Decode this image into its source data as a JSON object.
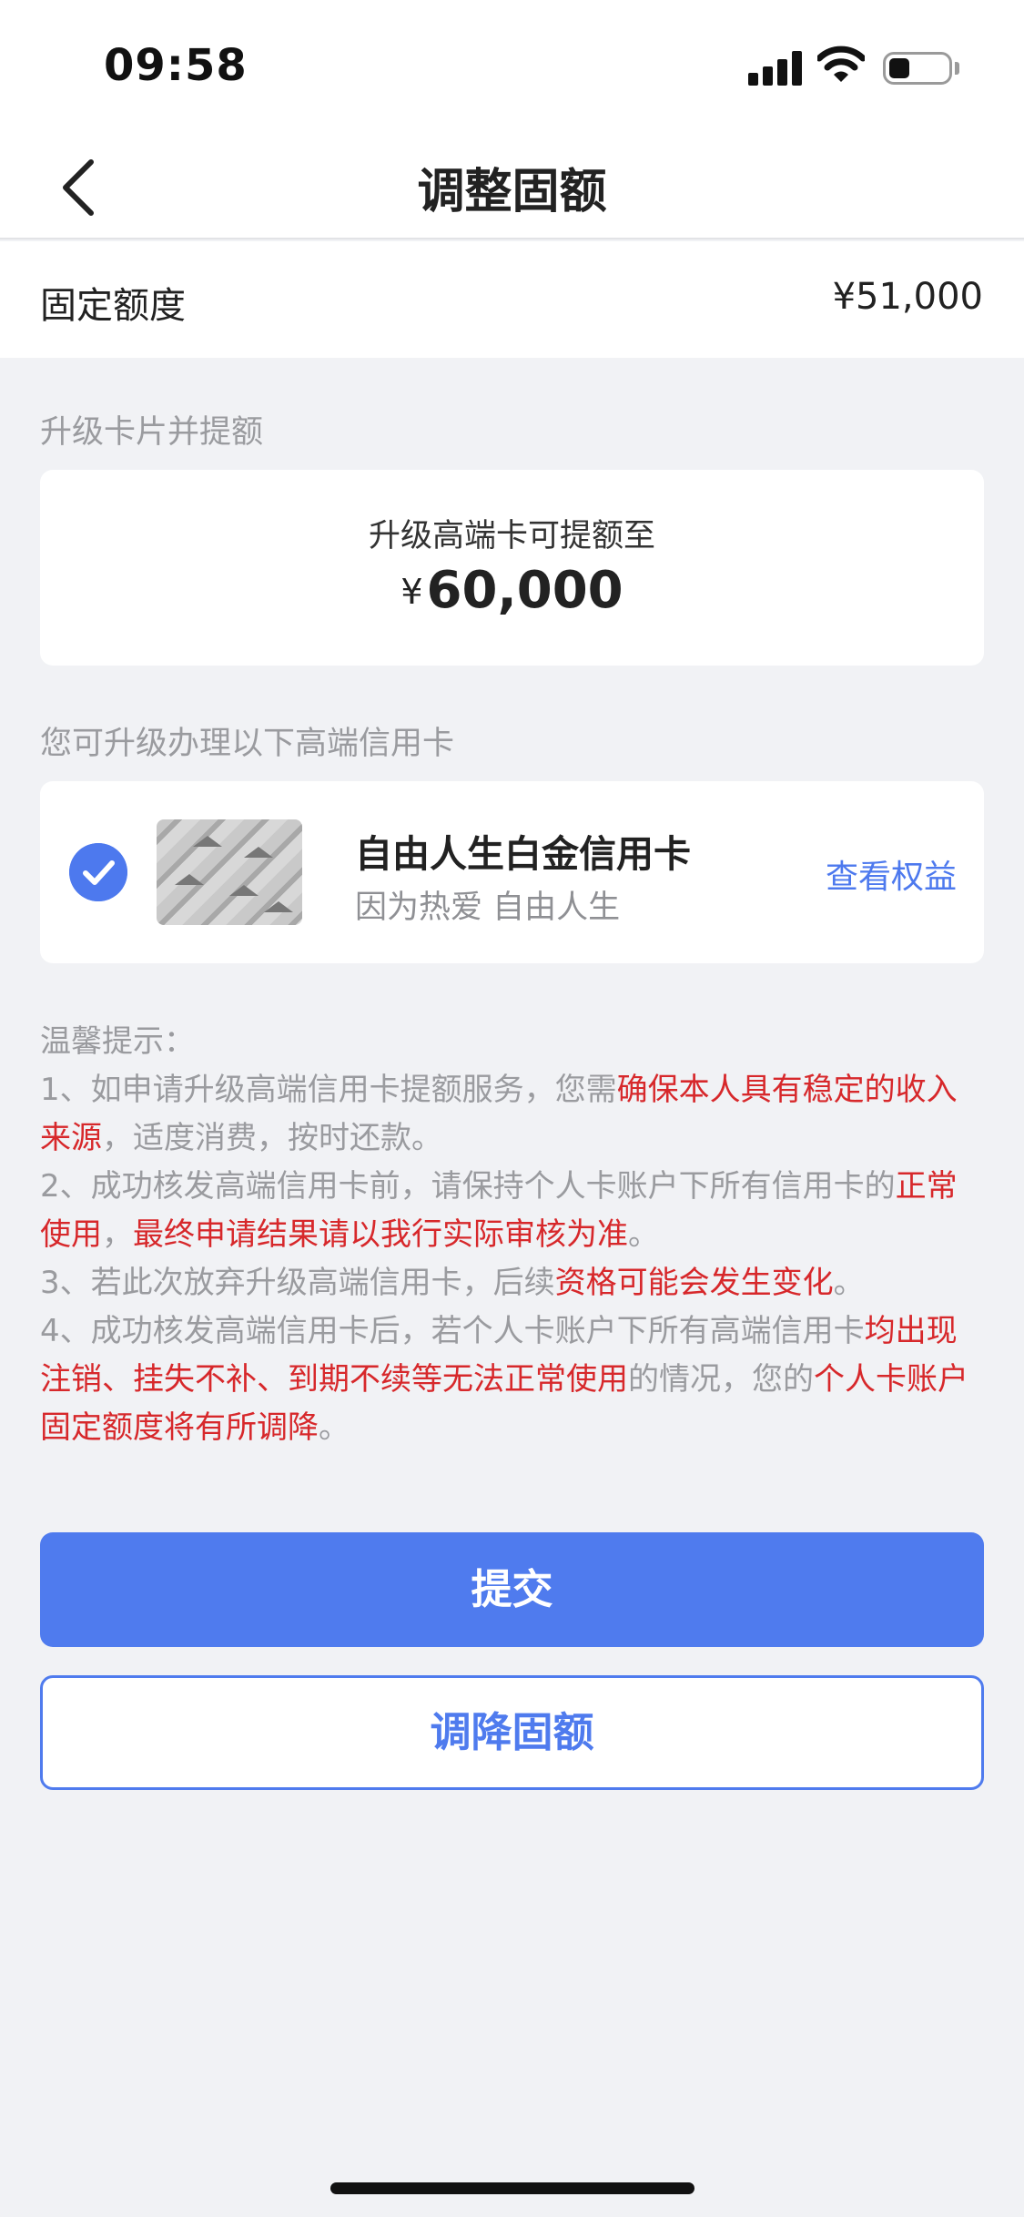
{
  "status_bar": {
    "time": "09:58"
  },
  "nav": {
    "title": "调整固额"
  },
  "fixed_limit": {
    "label": "固定额度",
    "value": "¥51,000"
  },
  "upgrade_section": {
    "label": "升级卡片并提额",
    "subtitle": "升级高端卡可提额至",
    "currency": "¥",
    "amount": "60,000"
  },
  "cards_section": {
    "label": "您可升级办理以下高端信用卡",
    "card": {
      "name": "自由人生白金信用卡",
      "slogan": "因为热爱 自由人生",
      "action": "查看权益",
      "selected": true
    }
  },
  "tips": {
    "title": "温馨提示：",
    "t1_a": "1、如申请升级高端信用卡提额服务，您需",
    "t1_b": "确保本人具有稳定的收入来源",
    "t1_c": "，适度消费，按时还款。",
    "t2_a": "2、成功核发高端信用卡前，请保持个人卡账户下所有信用卡的",
    "t2_b": "正常使用",
    "t2_c": "，",
    "t2_d": "最终申请结果请以我行实际审核为准",
    "t2_e": "。",
    "t3_a": "3、若此次放弃升级高端信用卡，后续",
    "t3_b": "资格可能会发生变化",
    "t3_c": "。",
    "t4_a": "4、成功核发高端信用卡后，若个人卡账户下所有高端信用卡",
    "t4_b": "均出现注销、挂失不补、到期不续等无法正常使用",
    "t4_c": "的情况，您的",
    "t4_d": "个人卡账户固定额度将有所调降",
    "t4_e": "。"
  },
  "buttons": {
    "submit": "提交",
    "reduce": "调降固额"
  },
  "colors": {
    "accent": "#4f7bee",
    "warning": "#d7282b",
    "background": "#f1f2f5"
  }
}
